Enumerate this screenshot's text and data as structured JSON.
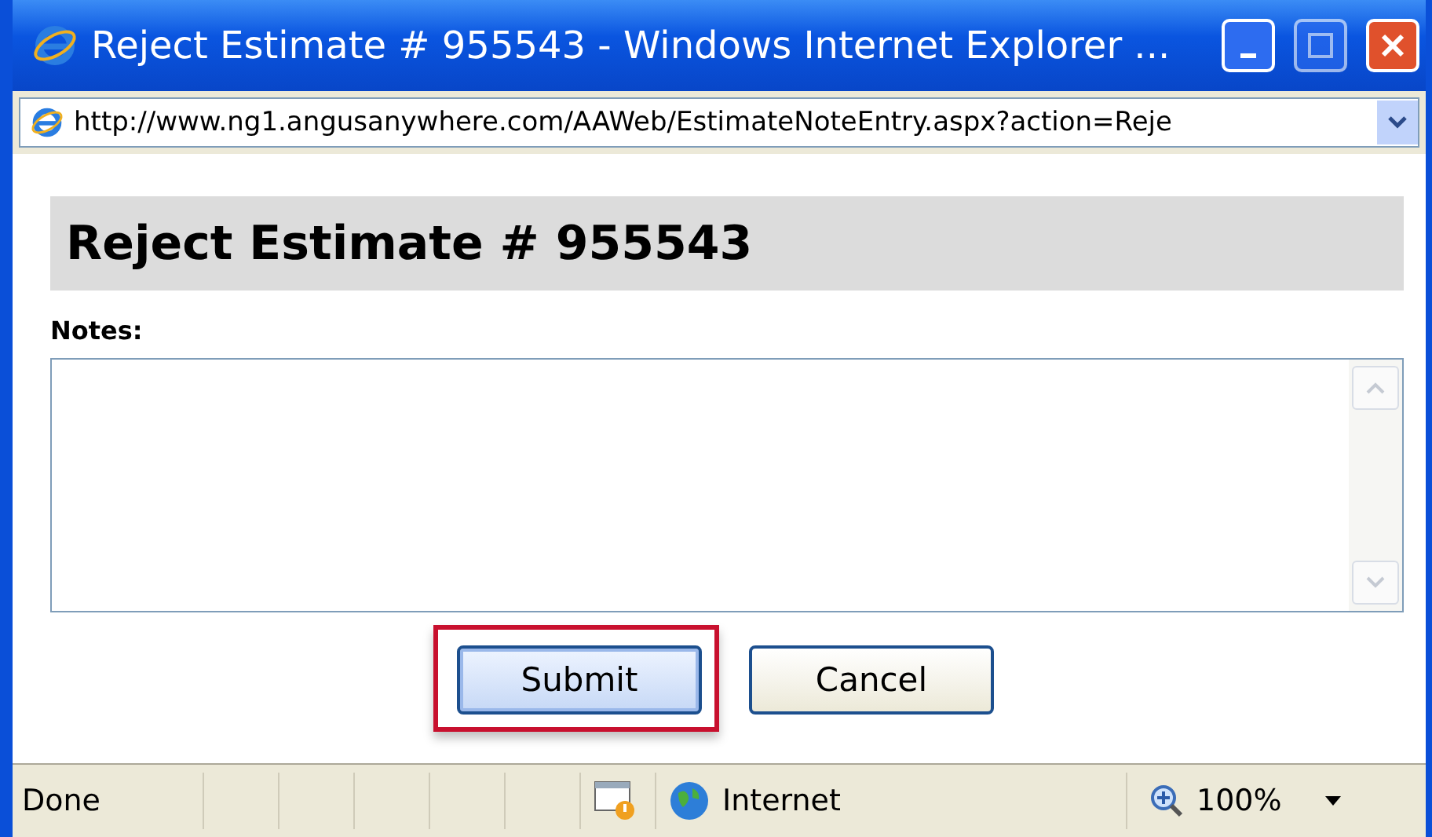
{
  "window": {
    "title": "Reject Estimate # 955543 - Windows Internet Explorer ..."
  },
  "address_bar": {
    "url": "http://www.ng1.angusanywhere.com/AAWeb/EstimateNoteEntry.aspx?action=Reje"
  },
  "page": {
    "heading": "Reject Estimate # 955543",
    "notes_label": "Notes:"
  },
  "buttons": [
    {
      "label": "Submit",
      "highlighted": true
    },
    {
      "label": "Cancel",
      "highlighted": false
    }
  ],
  "status_bar": {
    "status": "Done",
    "zone": "Internet",
    "zoom": "100%"
  }
}
